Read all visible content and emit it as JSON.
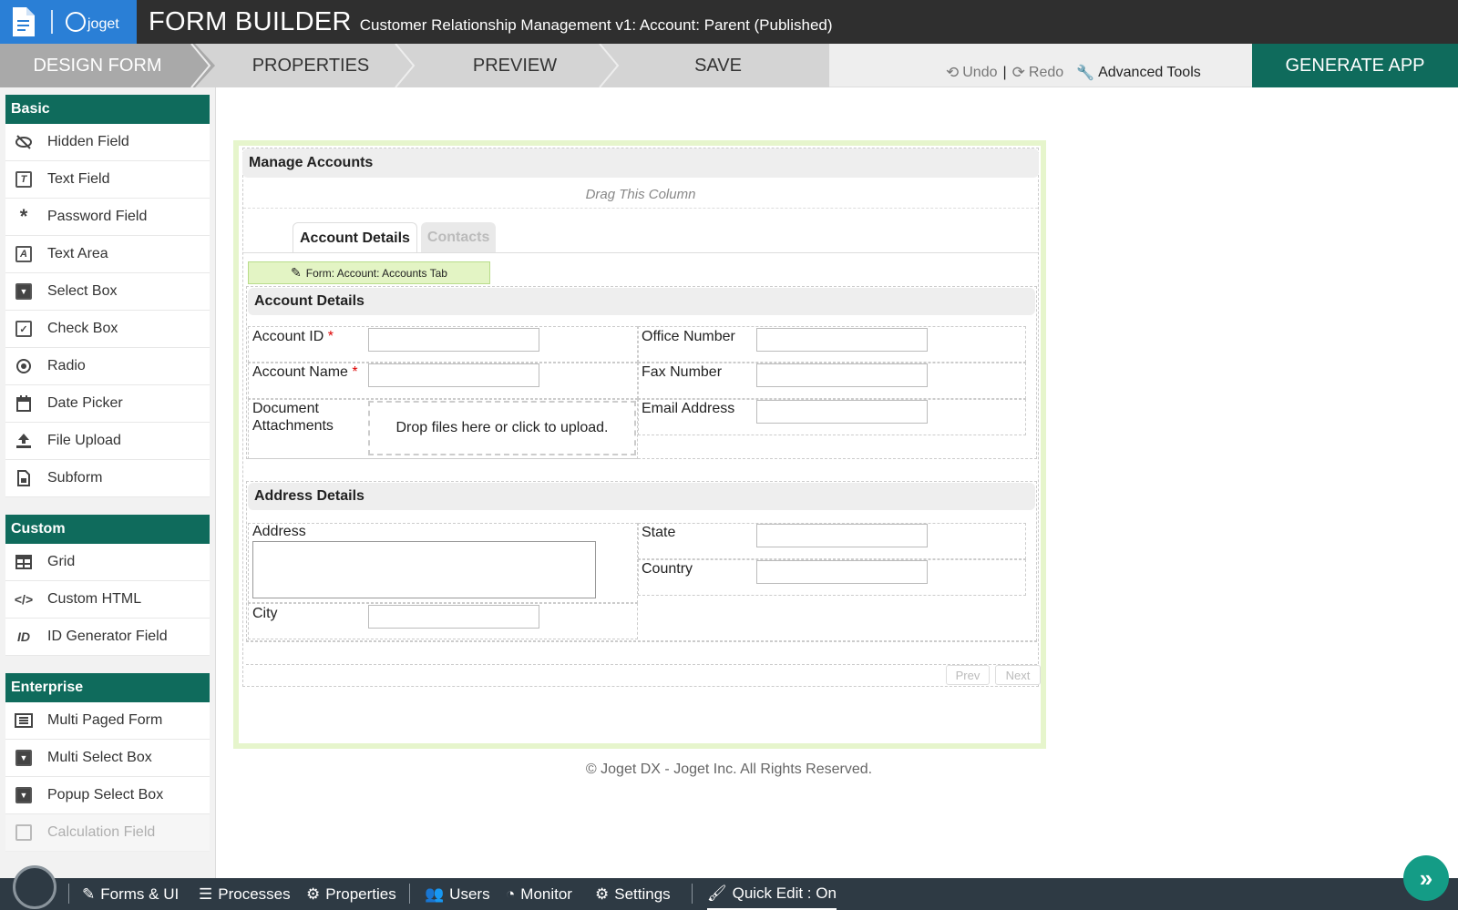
{
  "header": {
    "title": "FORM BUILDER",
    "subtitle": "Customer Relationship Management v1: Account: Parent (Published)",
    "logo_text": "joget"
  },
  "steps": [
    {
      "label": "DESIGN FORM",
      "active": true
    },
    {
      "label": "PROPERTIES",
      "active": false
    },
    {
      "label": "PREVIEW",
      "active": false
    },
    {
      "label": "SAVE",
      "active": false
    }
  ],
  "toolbar": {
    "undo": "Undo",
    "separator": "|",
    "redo": "Redo",
    "advanced_tools": "Advanced Tools",
    "generate_app": "GENERATE APP"
  },
  "sidebar": {
    "basic": {
      "title": "Basic",
      "items": [
        "Hidden Field",
        "Text Field",
        "Password Field",
        "Text Area",
        "Select Box",
        "Check Box",
        "Radio",
        "Date Picker",
        "File Upload",
        "Subform"
      ]
    },
    "custom": {
      "title": "Custom",
      "items": [
        "Grid",
        "Custom HTML",
        "ID Generator Field"
      ]
    },
    "enterprise": {
      "title": "Enterprise",
      "items": [
        "Multi Paged Form",
        "Multi Select Box",
        "Popup Select Box",
        "Calculation Field"
      ]
    }
  },
  "form": {
    "title": "Manage Accounts",
    "drag_hint": "Drag This Column",
    "tabs": [
      "Account Details",
      "Contacts"
    ],
    "subform_label": "Form: Account: Accounts Tab",
    "account_section": "Account Details",
    "address_section": "Address Details",
    "fields": {
      "account_id": "Account ID",
      "account_name": "Account Name",
      "required_mark": "*",
      "document_attachments": "Document Attachments",
      "upload_hint": "Drop files here or click to upload.",
      "office_number": "Office Number",
      "fax_number": "Fax Number",
      "email_address": "Email Address",
      "address": "Address",
      "city": "City",
      "state": "State",
      "country": "Country"
    },
    "prev": "Prev",
    "next": "Next"
  },
  "footer": "© Joget DX - Joget Inc. All Rights Reserved.",
  "bottom_bar": {
    "forms_ui": "Forms & UI",
    "processes": "Processes",
    "properties": "Properties",
    "users": "Users",
    "monitor": "Monitor",
    "settings": "Settings",
    "quick_edit": "Quick Edit : On"
  },
  "colors": {
    "accent_green": "#0f6b5c",
    "logo_blue": "#2a7fd6",
    "header_dark": "#2f2f2f",
    "canvas_border": "#e6f5cc"
  }
}
